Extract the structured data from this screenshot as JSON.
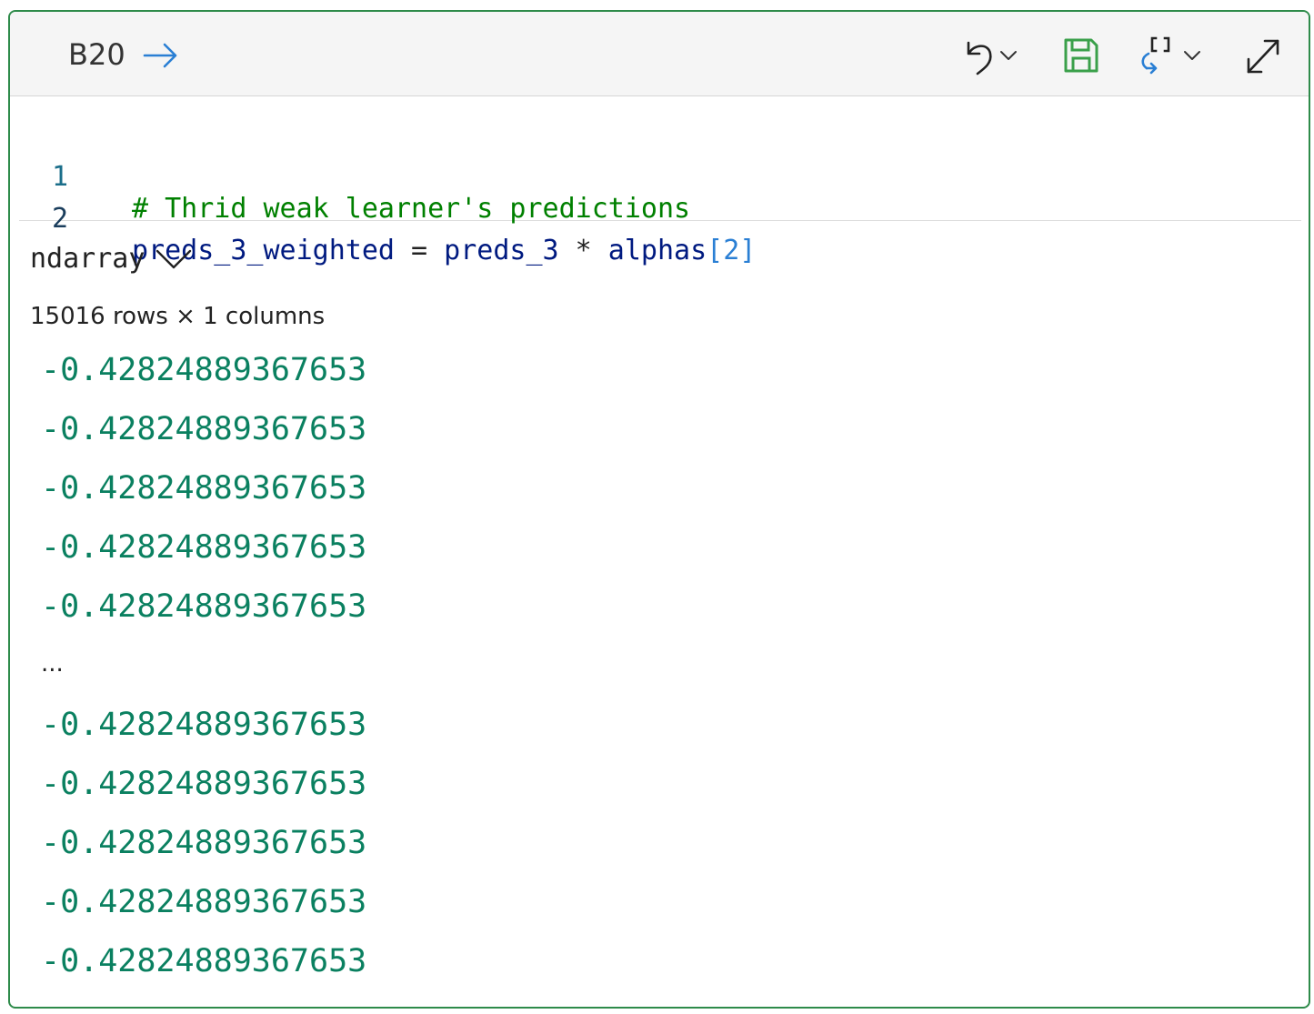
{
  "header": {
    "cell_ref": "B20",
    "tools": {
      "go": "arrow-right-icon",
      "undo": "undo-icon",
      "save": "save-icon",
      "convert": "bracket-convert-icon",
      "expand": "expand-icon"
    }
  },
  "code": {
    "lines": [
      {
        "num": "1",
        "comment": "# Thrid weak learner's predictions"
      },
      {
        "num": "2",
        "target": "preds_3_weighted",
        "eq": " = ",
        "lhs": "preds_3",
        "mul": " * ",
        "name": "alphas",
        "open": "[",
        "index": "2",
        "close": "]"
      }
    ]
  },
  "output": {
    "type_label": "ndarray",
    "shape": "15016 rows × 1 columns",
    "head": [
      "-0.42824889367653",
      "-0.42824889367653",
      "-0.42824889367653",
      "-0.42824889367653",
      "-0.42824889367653"
    ],
    "ellipsis": "...",
    "tail": [
      "-0.42824889367653",
      "-0.42824889367653",
      "-0.42824889367653",
      "-0.42824889367653",
      "-0.42824889367653"
    ]
  },
  "colors": {
    "border": "#2e8b4a",
    "comment": "#008000",
    "identifier": "#001a80",
    "value": "#0a8060",
    "accent": "#2a7fd4"
  }
}
